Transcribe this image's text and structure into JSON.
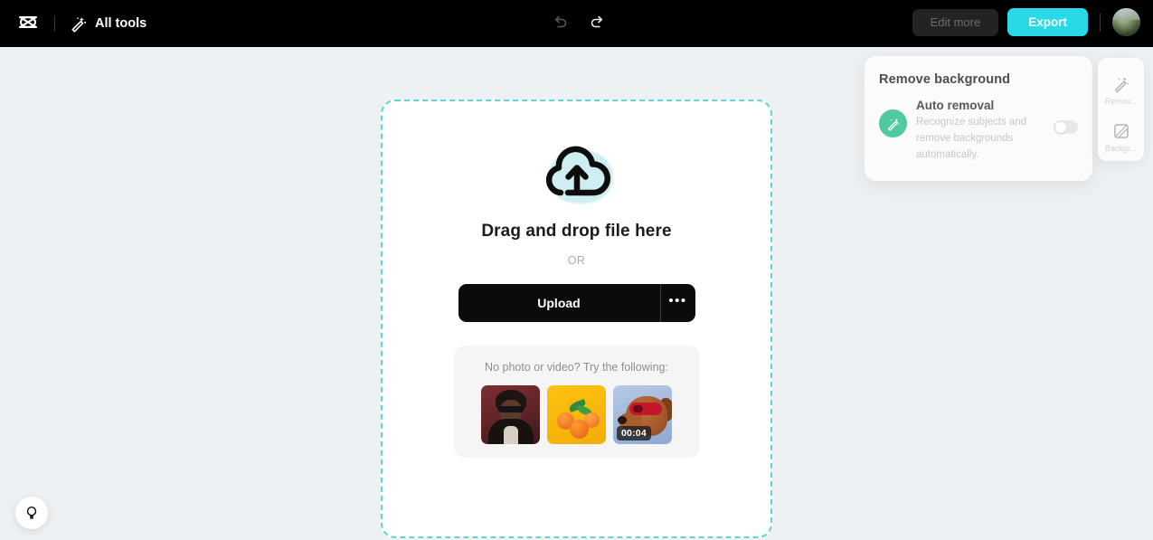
{
  "topbar": {
    "logo_icon": "capcut-logo-icon",
    "all_tools_label": "All tools",
    "all_tools_icon": "magic-wand-icon",
    "undo_icon": "undo-icon",
    "redo_icon": "redo-icon",
    "edit_more_label": "Edit more",
    "export_label": "Export",
    "avatar_icon": "user-avatar",
    "export_color": "#2ad9e8",
    "bar_color": "#000000"
  },
  "dropzone": {
    "cloud_icon": "cloud-upload-icon",
    "title": "Drag and drop file here",
    "or_label": "OR",
    "upload_label": "Upload",
    "more_label": "•••",
    "border_color": "#5fd6d3"
  },
  "samples": {
    "title": "No photo or video? Try the following:",
    "items": [
      {
        "name": "sample-portrait",
        "duration": ""
      },
      {
        "name": "sample-oranges",
        "duration": ""
      },
      {
        "name": "sample-dog-video",
        "duration": "00:04"
      }
    ]
  },
  "remove_background_panel": {
    "title": "Remove background",
    "option_name": "Auto removal",
    "option_desc": "Recognize subjects and remove backgrounds automatically.",
    "option_icon": "magic-wand-icon",
    "toggle_state": "off",
    "icon_color": "#4fc9a0"
  },
  "rail": {
    "items": [
      {
        "label": "Remov...",
        "icon": "magic-wand-icon"
      },
      {
        "label": "Backgr...",
        "icon": "image-square-icon"
      }
    ]
  },
  "help": {
    "icon": "lightbulb-icon"
  },
  "canvas": {
    "background_color": "#eef1f3"
  }
}
